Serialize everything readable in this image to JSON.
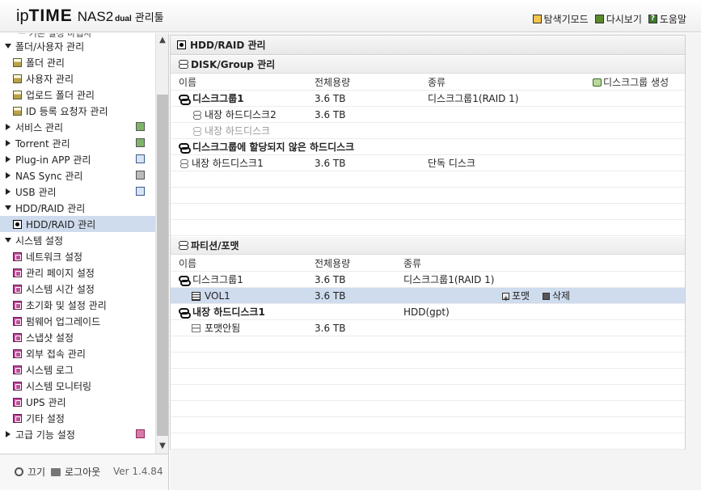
{
  "header": {
    "logo": {
      "ip": "ip",
      "time": "TIME",
      "model": "NAS2",
      "dual": "dual",
      "tool": "관리툴"
    },
    "links": [
      {
        "label": "탐색기모드",
        "icon": "folder-icon"
      },
      {
        "label": "다시보기",
        "icon": "refresh-icon"
      },
      {
        "label": "도움말",
        "icon": "help-icon"
      }
    ]
  },
  "sidebar": {
    "clipped_text": "ㅡ 기본 설정 마법사",
    "items": [
      {
        "label": "폴더/사용자 관리",
        "type": "group",
        "expanded": true
      },
      {
        "label": "폴더 관리",
        "type": "child",
        "icon": "doc-icon"
      },
      {
        "label": "사용자 관리",
        "type": "child",
        "icon": "doc-icon"
      },
      {
        "label": "업로드 폴더 관리",
        "type": "child",
        "icon": "doc-icon"
      },
      {
        "label": "ID 등록 요청자 관리",
        "type": "child",
        "icon": "doc-icon"
      },
      {
        "label": "서비스 관리",
        "type": "group",
        "expanded": false,
        "badge": "green"
      },
      {
        "label": "Torrent 관리",
        "type": "group",
        "expanded": false,
        "badge": "green"
      },
      {
        "label": "Plug-in APP 관리",
        "type": "group",
        "expanded": false,
        "badge": "blue"
      },
      {
        "label": "NAS Sync 관리",
        "type": "group",
        "expanded": false,
        "badge": "gray"
      },
      {
        "label": "USB 관리",
        "type": "group",
        "expanded": false,
        "badge": "blue"
      },
      {
        "label": "HDD/RAID 관리",
        "type": "group",
        "expanded": true
      },
      {
        "label": "HDD/RAID 관리",
        "type": "child",
        "icon": "disk-icon",
        "active": true
      },
      {
        "label": "시스템 설정",
        "type": "group",
        "expanded": true
      },
      {
        "label": "네트워크 설정",
        "type": "child",
        "icon": "settings-icon"
      },
      {
        "label": "관리 페이지 설정",
        "type": "child",
        "icon": "settings-icon"
      },
      {
        "label": "시스템 시간 설정",
        "type": "child",
        "icon": "settings-icon"
      },
      {
        "label": "초기화 및 설정 관리",
        "type": "child",
        "icon": "settings-icon"
      },
      {
        "label": "펌웨어 업그레이드",
        "type": "child",
        "icon": "settings-icon"
      },
      {
        "label": "스냅샷 설정",
        "type": "child",
        "icon": "settings-icon"
      },
      {
        "label": "외부 접속 관리",
        "type": "child",
        "icon": "settings-icon"
      },
      {
        "label": "시스템 로그",
        "type": "child",
        "icon": "settings-icon"
      },
      {
        "label": "시스템 모니터링",
        "type": "child",
        "icon": "settings-icon"
      },
      {
        "label": "UPS 관리",
        "type": "child",
        "icon": "settings-icon"
      },
      {
        "label": "기타 설정",
        "type": "child",
        "icon": "settings-icon"
      },
      {
        "label": "고급 기능 설정",
        "type": "group",
        "expanded": false,
        "badge": "pink"
      }
    ],
    "footer": {
      "power": "끄기",
      "logout": "로그아웃",
      "version": "Ver 1.4.84"
    }
  },
  "main": {
    "title": "HDD/RAID 관리",
    "disk_section": {
      "title": "DISK/Group 관리",
      "columns": [
        "이름",
        "전체용량",
        "종류"
      ],
      "create_label": "디스크그룹 생성",
      "rows": [
        {
          "name": "디스크그룹1",
          "capacity": "3.6 TB",
          "type": "디스크그룹1(RAID 1)",
          "style": "group"
        },
        {
          "name": "내장 하드디스크2",
          "capacity": "3.6 TB",
          "type": "",
          "style": "member"
        },
        {
          "name": "내장 하드디스크",
          "capacity": "",
          "type": "",
          "style": "member-dim"
        },
        {
          "name": "디스크그룹에 할당되지 않은 하드디스크",
          "capacity": "",
          "type": "",
          "style": "group"
        },
        {
          "name": "내장 하드디스크1",
          "capacity": "3.6 TB",
          "type": "단독 디스크",
          "style": "single"
        }
      ]
    },
    "partition_section": {
      "title": "파티션/포맷",
      "columns": [
        "이름",
        "전체용량",
        "종류"
      ],
      "rows": [
        {
          "name": "디스크그룹1",
          "capacity": "3.6 TB",
          "type": "디스크그룹1(RAID 1)",
          "style": "group-normal"
        },
        {
          "name": "VOL1",
          "capacity": "3.6 TB",
          "type": "",
          "style": "volume",
          "selected": true,
          "format_label": "포맷",
          "delete_label": "삭제"
        },
        {
          "name": "내장 하드디스크1",
          "capacity": "",
          "type": "HDD(gpt)",
          "style": "group"
        },
        {
          "name": "포맷안됨",
          "capacity": "3.6 TB",
          "type": "",
          "style": "unformatted"
        }
      ]
    }
  }
}
